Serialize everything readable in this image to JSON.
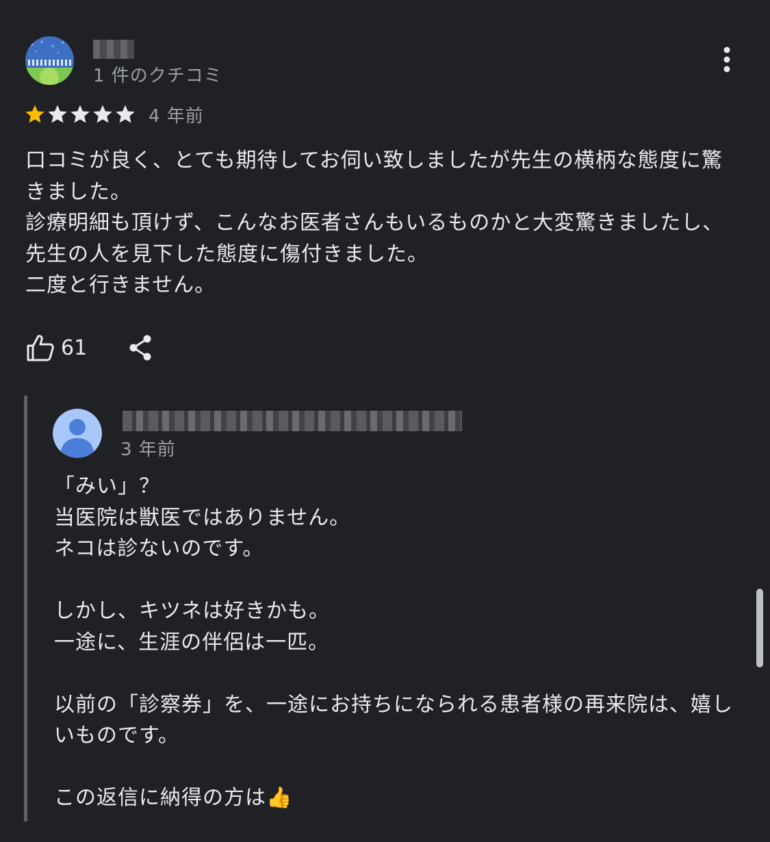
{
  "review": {
    "author_count": "1 件のクチコミ",
    "rating": 1,
    "rating_max": 5,
    "date": "4 年前",
    "text_lines": [
      "口コミが良く、とても期待してお伺い致しましたが先生の横柄な態度に驚",
      "きました。",
      "診療明細も頂けず、こんなお医者さんもいるものかと大変驚きましたし、",
      "先生の人を見下した態度に傷付きました。",
      "二度と行きません。"
    ],
    "likes": "61",
    "colors": {
      "star_filled": "#fbbc04",
      "star_empty": "#e8eaed"
    },
    "icons": {
      "menu": "more-vert-icon",
      "like": "thumb-up-icon",
      "share": "share-icon"
    }
  },
  "reply": {
    "date": "3 年前",
    "text_lines": [
      "「みい」？",
      "当医院は獣医ではありません。",
      "ネコは診ないのです。",
      "",
      "しかし、キツネは好きかも。",
      "一途に、生涯の伴侶は一匹。",
      "",
      "以前の「診察券」を、一途にお持ちになられる患者様の再来院は、嬉し",
      "いものです。",
      "",
      "この返信に納得の方は👍"
    ]
  }
}
